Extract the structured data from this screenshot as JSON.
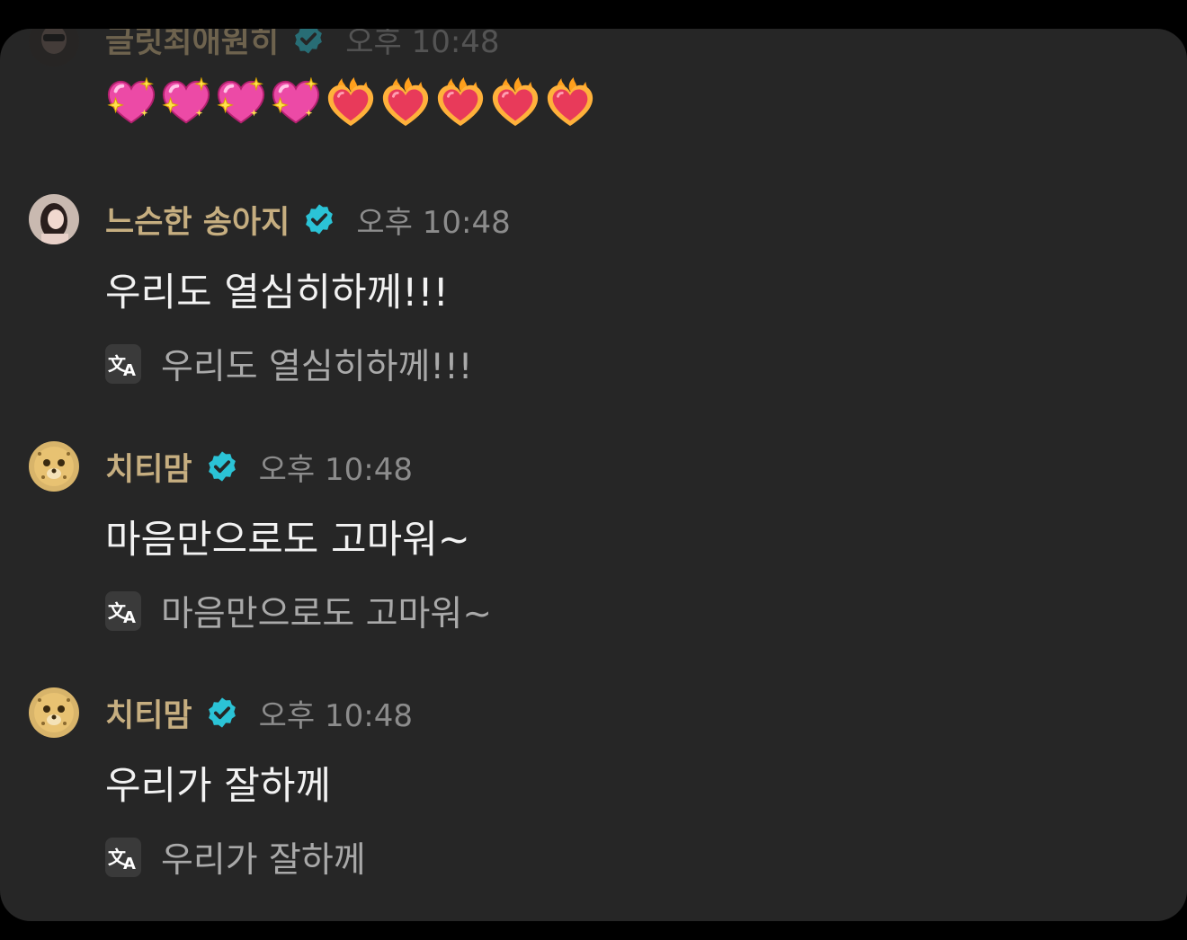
{
  "colors": {
    "background": "#000000",
    "panel": "#262626",
    "name": "#c6ae80",
    "time": "#8c8c8c",
    "message": "#f2f2f2",
    "translation": "#a9a9a9",
    "badge": "#2bc3d6",
    "sparkle_heart": "#ec4aa6",
    "fire_heart": "#e83a5a"
  },
  "messages": [
    {
      "author": "글릿최애원히",
      "time": "오후 10:48",
      "verified": true,
      "emojis": [
        "sparkling-heart",
        "sparkling-heart",
        "sparkling-heart",
        "sparkling-heart",
        "heart-on-fire",
        "heart-on-fire",
        "heart-on-fire",
        "heart-on-fire",
        "heart-on-fire"
      ]
    },
    {
      "author": "느슨한 송아지",
      "time": "오후 10:48",
      "verified": true,
      "text": "우리도 열심히하께!!!",
      "translation": "우리도 열심히하께!!!"
    },
    {
      "author": "치티맘",
      "time": "오후 10:48",
      "verified": true,
      "text": "마음만으로도 고마워~",
      "translation": "마음만으로도 고마워~"
    },
    {
      "author": "치티맘",
      "time": "오후 10:48",
      "verified": true,
      "text": "우리가 잘하께",
      "translation": "우리가 잘하께"
    }
  ]
}
